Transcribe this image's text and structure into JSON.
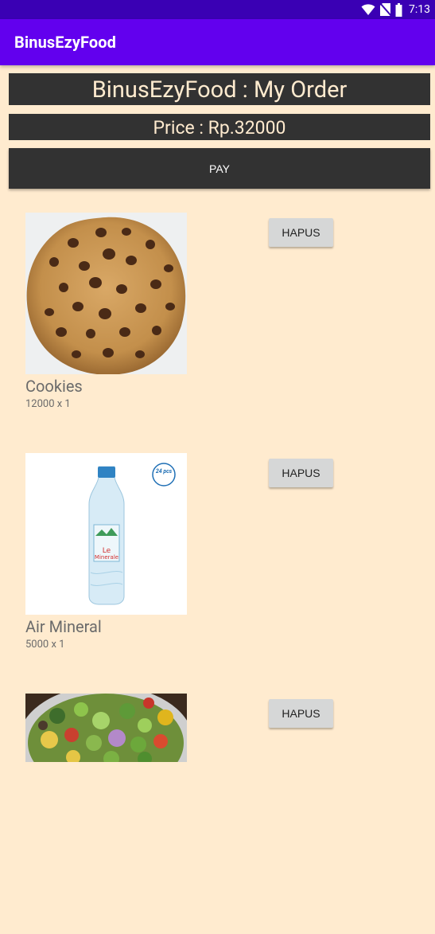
{
  "status_bar": {
    "time": "7:13",
    "icons": [
      "wifi-icon",
      "no-sim-icon",
      "battery-icon"
    ]
  },
  "app_bar": {
    "title": "BinusEzyFood"
  },
  "order_header": {
    "title": "BinusEzyFood : My Order",
    "price": "Price : Rp.32000"
  },
  "pay_button": {
    "label": "PAY"
  },
  "items": [
    {
      "name": "Cookies",
      "qty": "12000 x 1",
      "button": "HAPUS",
      "image": "cookie-image"
    },
    {
      "name": "Air Mineral",
      "qty": "5000 x 1",
      "button": "HAPUS",
      "image": "water-bottle-image",
      "badge": "24 pcs"
    },
    {
      "name": "",
      "qty": "",
      "button": "HAPUS",
      "image": "salad-image"
    }
  ],
  "colors": {
    "background": "#ffebcf",
    "status_bar": "#3a00b4",
    "app_bar": "#6200ee",
    "header": "#323232",
    "button": "#d6d7d7"
  }
}
